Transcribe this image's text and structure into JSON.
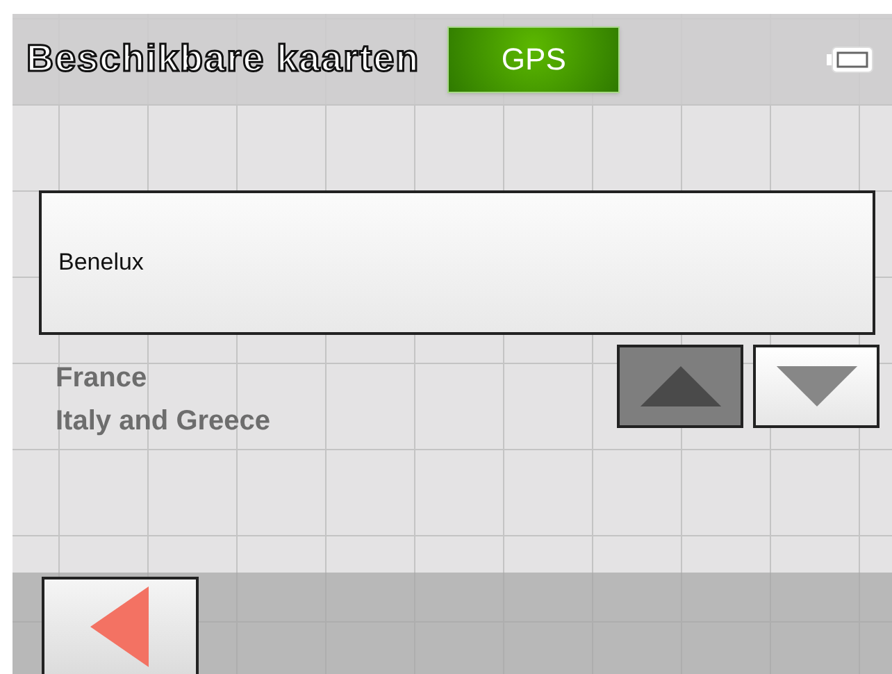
{
  "header": {
    "title": "Beschikbare kaarten",
    "gps_badge": "GPS"
  },
  "maps": [
    {
      "name": "Benelux",
      "selected": true
    },
    {
      "name": "France",
      "selected": false
    },
    {
      "name": "Italy and Greece",
      "selected": false
    }
  ],
  "scroll_buttons": [
    {
      "kind": "up",
      "disabled": true
    },
    {
      "kind": "down",
      "disabled": false
    }
  ]
}
